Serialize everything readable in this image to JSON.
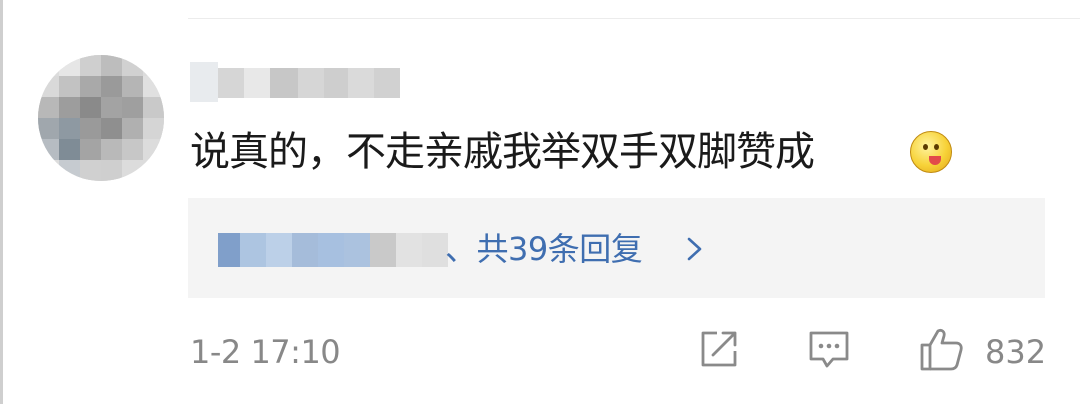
{
  "comment": {
    "avatar_icon": "avatar-pixelated",
    "username": "",
    "text": "说真的，不走亲戚我举双手双脚赞成",
    "emoji_icon": "tongue-out-face-emoji",
    "replies": {
      "summary": "、共39条回复",
      "chevron_icon": "chevron-right-icon"
    },
    "timestamp": "1-2 17:10",
    "actions": {
      "share_icon": "share-icon",
      "comment_icon": "comment-icon",
      "like_icon": "thumbs-up-icon",
      "like_count": "832"
    }
  },
  "colors": {
    "text": "#1a1a1a",
    "meta": "#888888",
    "link": "#3f6eb0",
    "reply_bg": "#f4f4f4"
  }
}
